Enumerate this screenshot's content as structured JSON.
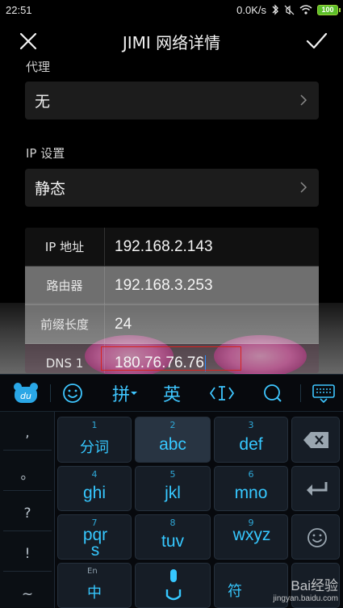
{
  "status_bar": {
    "time": "22:51",
    "net_speed": "0.0K/s",
    "battery": "100"
  },
  "header": {
    "title": "JIMI 网络详情",
    "close_icon": "close-icon",
    "confirm_icon": "checkmark-icon"
  },
  "proxy": {
    "label": "代理",
    "value": "无"
  },
  "ip_settings": {
    "label": "IP 设置",
    "value": "静态"
  },
  "ip_table": [
    {
      "label": "IP 地址",
      "value": "192.168.2.143"
    },
    {
      "label": "路由器",
      "value": "192.168.3.253"
    },
    {
      "label": "前缀长度",
      "value": "24"
    },
    {
      "label": "DNS 1",
      "value": "180.76.76.76"
    }
  ],
  "keyboard": {
    "toolbar": {
      "pinyin": "拼",
      "english": "英",
      "cursor_icon": "cursor-move-icon",
      "search_icon": "search-icon",
      "emoji_icon": "smiley-icon",
      "logo_icon": "du-logo-icon",
      "hide_icon": "keyboard-hide-icon"
    },
    "side_keys": [
      ",",
      "。",
      "?",
      "!",
      "~"
    ],
    "keys": [
      {
        "num": "1",
        "label": "分词"
      },
      {
        "num": "2",
        "label": "abc"
      },
      {
        "num": "3",
        "label": "def"
      },
      {
        "num": "4",
        "label": "ghi"
      },
      {
        "num": "5",
        "label": "jkl"
      },
      {
        "num": "6",
        "label": "mno"
      },
      {
        "num": "7",
        "label": "pqrs"
      },
      {
        "num": "8",
        "label": "tuv"
      },
      {
        "num": "9",
        "label": "wxyz"
      }
    ],
    "bottom_row": {
      "lang_small": "En",
      "lang_label": "中",
      "symbol_label": "符"
    },
    "delete_icon": "backspace-icon",
    "enter_icon": "enter-icon",
    "emoji_key_icon": "smiley-icon",
    "mic_icon": "microphone-icon"
  },
  "watermark": {
    "brand": "Bai经验",
    "url": "jingyan.baidu.com"
  }
}
